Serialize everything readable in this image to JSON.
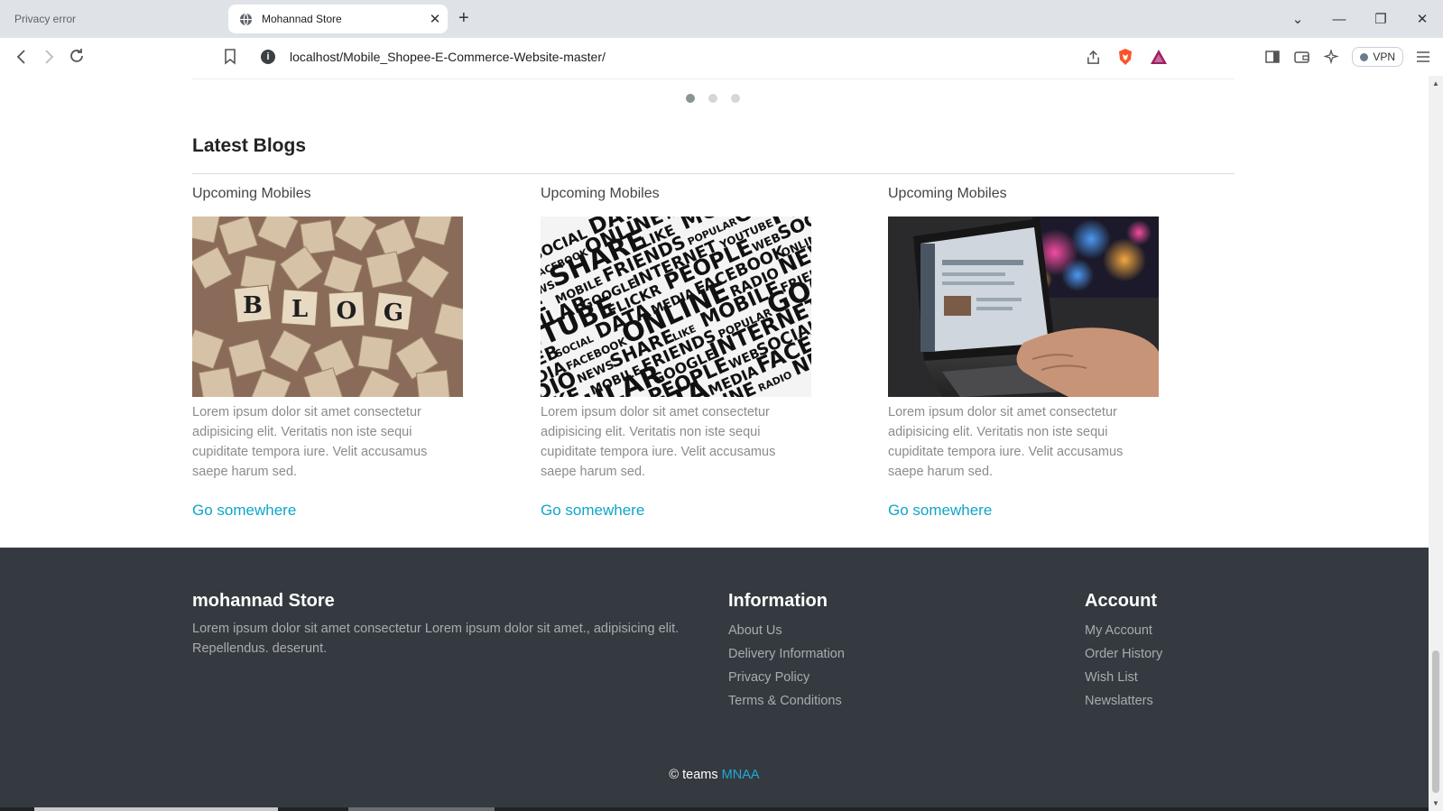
{
  "browser": {
    "inactive_tab": "Privacy error",
    "active_tab": "Mohannad Store",
    "tab_close": "✕",
    "new_tab": "+",
    "url": "localhost/Mobile_Shopee-E-Commerce-Website-master/",
    "vpn_label": "VPN",
    "win_controls": [
      "⌄",
      "—",
      "❐",
      "✕"
    ]
  },
  "carousel": {
    "dot_count": 3,
    "active_dot": 1
  },
  "blogs": {
    "heading": "Latest Blogs",
    "cards": [
      {
        "title": "Upcoming Mobiles",
        "image": "scrabble-blog-tiles",
        "tile_letters": [
          "B",
          "L",
          "O",
          "G"
        ],
        "text": "Lorem ipsum dolor sit amet consectetur adipisicing elit. Veritatis non iste sequi cupiditate tempora iure. Velit accusamus saepe harum sed.",
        "link": "Go somewhere"
      },
      {
        "title": "Upcoming Mobiles",
        "image": "web-word-cloud",
        "cloud_words": [
          "WEB",
          "SOCIAL",
          "DATA",
          "MEDIA",
          "FACEBOOK",
          "ONLINE",
          "RADIO",
          "NEWS",
          "SHARE",
          "LIKE",
          "MOBILE",
          "FRIENDS",
          "POPULAR",
          "GOOGLE",
          "INTERNET",
          "YOUTUBE",
          "FLICKR",
          "PEOPLE"
        ],
        "text": "Lorem ipsum dolor sit amet consectetur adipisicing elit. Veritatis non iste sequi cupiditate tempora iure. Velit accusamus saepe harum sed.",
        "link": "Go somewhere"
      },
      {
        "title": "Upcoming Mobiles",
        "image": "laptop-typing-photo",
        "text": "Lorem ipsum dolor sit amet consectetur adipisicing elit. Veritatis non iste sequi cupiditate tempora iure. Velit accusamus saepe harum sed.",
        "link": "Go somewhere"
      }
    ]
  },
  "footer": {
    "store": {
      "title": "mohannad Store",
      "text": "Lorem ipsum dolor sit amet consectetur Lorem ipsum dolor sit amet., adipisicing elit. Repellendus. deserunt."
    },
    "information": {
      "title": "Information",
      "links": [
        "About Us",
        "Delivery Information",
        "Privacy Policy",
        "Terms & Conditions"
      ]
    },
    "account": {
      "title": "Account",
      "links": [
        "My Account",
        "Order History",
        "Wish List",
        "Newslatters"
      ]
    },
    "copyright_prefix": "© teams",
    "copyright_brand": "MNAA"
  },
  "colors": {
    "link": "#0fa5c7",
    "footer_bg": "#343a40",
    "brand": "#1fa9d6"
  }
}
